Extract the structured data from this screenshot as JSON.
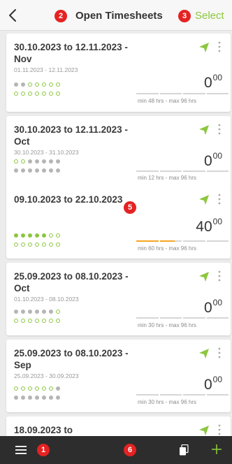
{
  "header": {
    "title": "Open Timesheets",
    "select_label": "Select"
  },
  "annotations": {
    "menu": "1",
    "title": "2",
    "select": "3",
    "card": "5",
    "bottom": "6"
  },
  "colors": {
    "accent_green": "#8cc63f",
    "badge_red": "#e52222",
    "bar_fill": "#f5a623",
    "bottom_bar": "#2d2d2d"
  },
  "icons": {
    "back": "chevron-left-icon",
    "send": "paper-plane-icon",
    "more": "kebab-icon",
    "menu": "hamburger-icon",
    "copy": "copy-icon",
    "add": "plus-icon"
  },
  "timesheets": [
    {
      "title": "30.10.2023 to 12.11.2023 - Nov",
      "range": "01.11.2023 - 12.11.2023",
      "hours": "0",
      "minutes": "00",
      "min_max": "min 48 hrs - max 96 hrs",
      "progress": 0,
      "dots_row1": [
        "grey",
        "grey",
        "green-ring",
        "green-ring",
        "green-ring",
        "green-ring",
        "green-ring"
      ],
      "dots_row2": [
        "green-ring",
        "green-ring",
        "green-ring",
        "green-ring",
        "green-ring",
        "green-ring",
        "green-ring"
      ]
    },
    {
      "title": "30.10.2023 to 12.11.2023 - Oct",
      "range": "30.10.2023 - 31.10.2023",
      "hours": "0",
      "minutes": "00",
      "min_max": "min 12 hrs - max 96 hrs",
      "progress": 0,
      "dots_row1": [
        "green-ring",
        "green-ring",
        "grey",
        "grey",
        "grey",
        "grey",
        "grey"
      ],
      "dots_row2": [
        "grey",
        "grey",
        "grey",
        "grey",
        "grey",
        "grey",
        "grey"
      ]
    },
    {
      "title": "09.10.2023 to 22.10.2023",
      "range": "",
      "hours": "40",
      "minutes": "00",
      "min_max": "min 60 hrs - max 96 hrs",
      "progress": 0.417,
      "dots_row1": [
        "green-fill",
        "green-fill",
        "green-fill",
        "green-fill",
        "green-fill",
        "green-ring",
        "green-ring"
      ],
      "dots_row2": [
        "green-ring",
        "green-ring",
        "green-ring",
        "green-ring",
        "green-ring",
        "green-ring",
        "green-ring"
      ]
    },
    {
      "title": "25.09.2023 to 08.10.2023 - Oct",
      "range": "01.10.2023 - 08.10.2023",
      "hours": "0",
      "minutes": "00",
      "min_max": "min 30 hrs - max 96 hrs",
      "progress": 0,
      "dots_row1": [
        "grey",
        "grey",
        "grey",
        "grey",
        "grey",
        "grey",
        "green-ring"
      ],
      "dots_row2": [
        "green-ring",
        "green-ring",
        "green-ring",
        "green-ring",
        "green-ring",
        "green-ring",
        "green-ring"
      ]
    },
    {
      "title": "25.09.2023 to 08.10.2023 - Sep",
      "range": "25.09.2023 - 30.09.2023",
      "hours": "0",
      "minutes": "00",
      "min_max": "min 30 hrs - max 96 hrs",
      "progress": 0,
      "dots_row1": [
        "green-ring",
        "green-ring",
        "green-ring",
        "green-ring",
        "green-ring",
        "green-ring",
        "grey"
      ],
      "dots_row2": [
        "grey",
        "grey",
        "grey",
        "grey",
        "grey",
        "grey",
        "grey"
      ]
    },
    {
      "title": "18.09.2023 to",
      "range": "",
      "hours": "",
      "minutes": "",
      "min_max": "",
      "progress": 0,
      "dots_row1": [],
      "dots_row2": []
    }
  ]
}
